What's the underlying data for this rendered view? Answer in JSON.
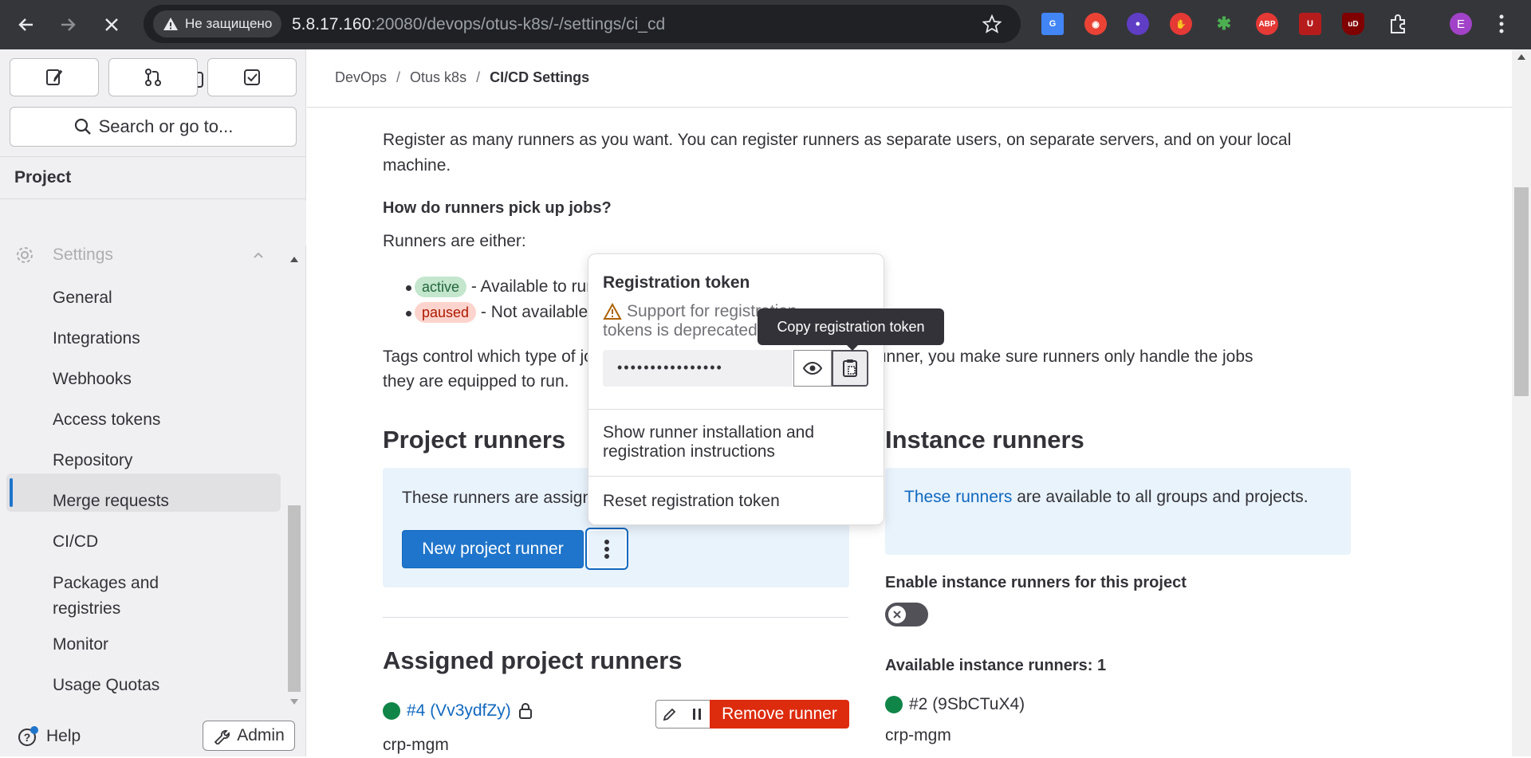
{
  "browser": {
    "security_label": "Не защищено",
    "url_host": "5.8.17.160",
    "url_rest": ":20080/devops/otus-k8s/-/settings/ci_cd",
    "profile_initial": "E",
    "extensions": [
      "translate-icon",
      "opera-icon",
      "spy-icon",
      "hand-icon",
      "puzzle-color-icon",
      "abp-icon",
      "ublock-icon",
      "ud-icon",
      "extensions-icon"
    ]
  },
  "sidebar": {
    "search_placeholder": "Search or go to...",
    "section_title": "Project",
    "settings_label": "Settings",
    "items": [
      {
        "label": "General"
      },
      {
        "label": "Integrations"
      },
      {
        "label": "Webhooks"
      },
      {
        "label": "Access tokens"
      },
      {
        "label": "Repository"
      },
      {
        "label": "Merge requests"
      },
      {
        "label": "CI/CD",
        "active": true
      },
      {
        "label": "Packages and registries"
      },
      {
        "label": "Monitor"
      },
      {
        "label": "Usage Quotas"
      }
    ],
    "help_label": "Help",
    "admin_label": "Admin"
  },
  "breadcrumb": {
    "items": [
      "DevOps",
      "Otus k8s",
      "CI/CD Settings"
    ]
  },
  "content": {
    "intro": "Register as many runners as you want. You can register runners as separate users, on separate servers, and on your local machine.",
    "pickup_heading": "How do runners pick up jobs?",
    "runners_either": "Runners are either:",
    "active_badge": "active",
    "active_text": "- Available to run jobs.",
    "paused_badge": "paused",
    "paused_text": "- Not available to run jobs.",
    "tags_text_start": "Tags control which type of jobs a runner can handle. By tagging a runner, you make sure runners only handle the jobs",
    "tags_text_end": "they are equipped to run.",
    "project_runners_title": "Project runners",
    "project_runners_desc": "These runners are assigned to this project.",
    "new_runner_button": "New project runner",
    "assigned_title": "Assigned project runners",
    "assigned_runner_link": "#4 (Vv3ydfZy)",
    "assigned_runner_desc": "crp-mgm",
    "remove_runner_button": "Remove runner",
    "instance_runners_title": "Instance runners",
    "instance_link": "These runners",
    "instance_desc": " are available to all groups and projects.",
    "enable_instance_label": "Enable instance runners for this project",
    "available_instance_label": "Available instance runners: 1",
    "instance_runner_name": "#2 (9SbCTuX4)",
    "instance_runner_desc": "crp-mgm"
  },
  "popover": {
    "title": "Registration token",
    "warning": "Support for registration tokens is deprecated",
    "token_mask": "••••••••••••••••",
    "show_instructions": "Show runner installation and registration instructions",
    "reset_token": "Reset registration token"
  },
  "tooltip": {
    "text": "Copy registration token"
  }
}
